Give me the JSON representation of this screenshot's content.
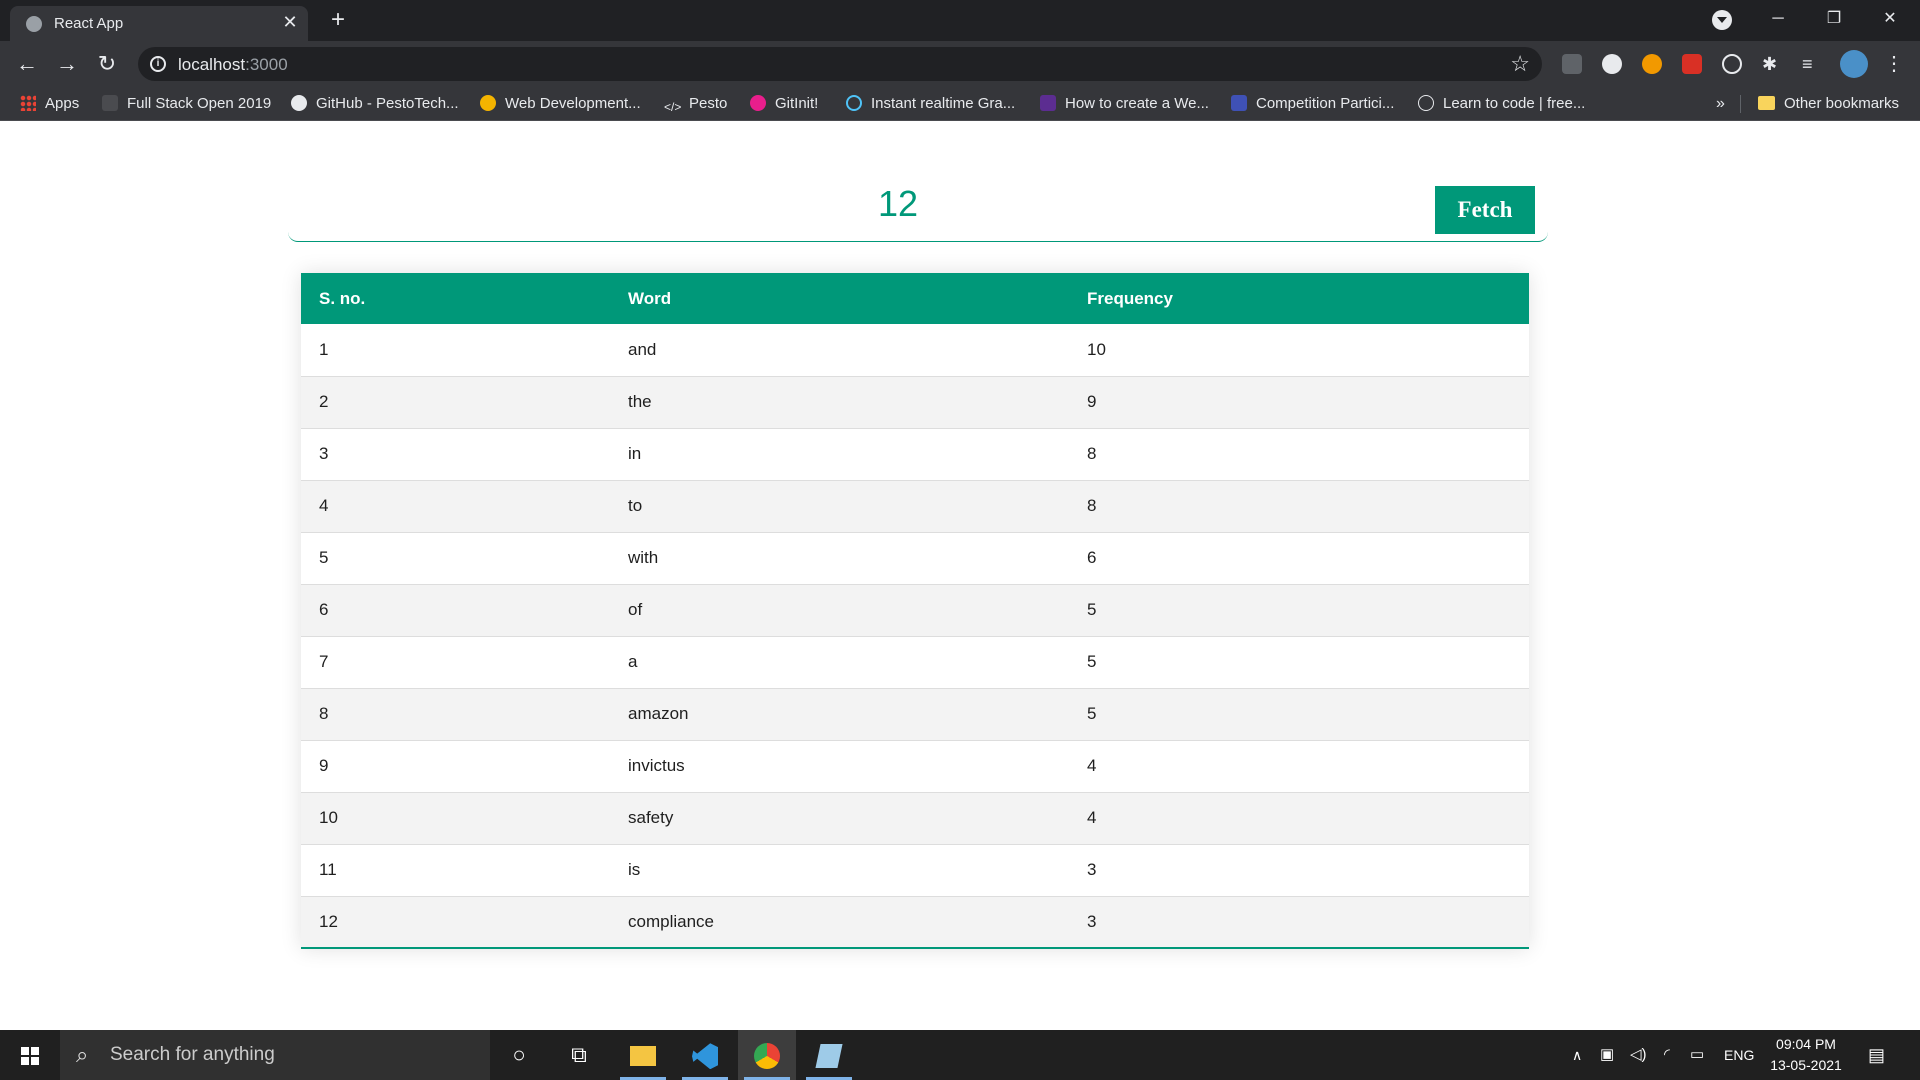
{
  "browser": {
    "tab_title": "React App",
    "new_tab": "+",
    "url_host": "localhost",
    "url_port": ":3000",
    "window_controls": {
      "minimize": "─",
      "restore": "❐",
      "close": "✕"
    }
  },
  "bookmarks": {
    "apps": "Apps",
    "items": [
      "Full Stack Open 2019",
      "GitHub - PestoTech...",
      "Web Development...",
      "Pesto",
      "GitInit!",
      "Instant realtime Gra...",
      "How to create a We...",
      "Competition Partici...",
      "Learn to code | free..."
    ],
    "more": "»",
    "other": "Other bookmarks"
  },
  "app": {
    "count_value": "12",
    "fetch_label": "Fetch",
    "accent_color": "#009879",
    "table": {
      "headers": [
        "S. no.",
        "Word",
        "Frequency"
      ],
      "rows": [
        [
          "1",
          "and",
          "10"
        ],
        [
          "2",
          "the",
          "9"
        ],
        [
          "3",
          "in",
          "8"
        ],
        [
          "4",
          "to",
          "8"
        ],
        [
          "5",
          "with",
          "6"
        ],
        [
          "6",
          "of",
          "5"
        ],
        [
          "7",
          "a",
          "5"
        ],
        [
          "8",
          "amazon",
          "5"
        ],
        [
          "9",
          "invictus",
          "4"
        ],
        [
          "10",
          "safety",
          "4"
        ],
        [
          "11",
          "is",
          "3"
        ],
        [
          "12",
          "compliance",
          "3"
        ]
      ]
    }
  },
  "taskbar": {
    "search_placeholder": "Search for anything",
    "language": "ENG",
    "time": "09:04 PM",
    "date": "13-05-2021"
  }
}
